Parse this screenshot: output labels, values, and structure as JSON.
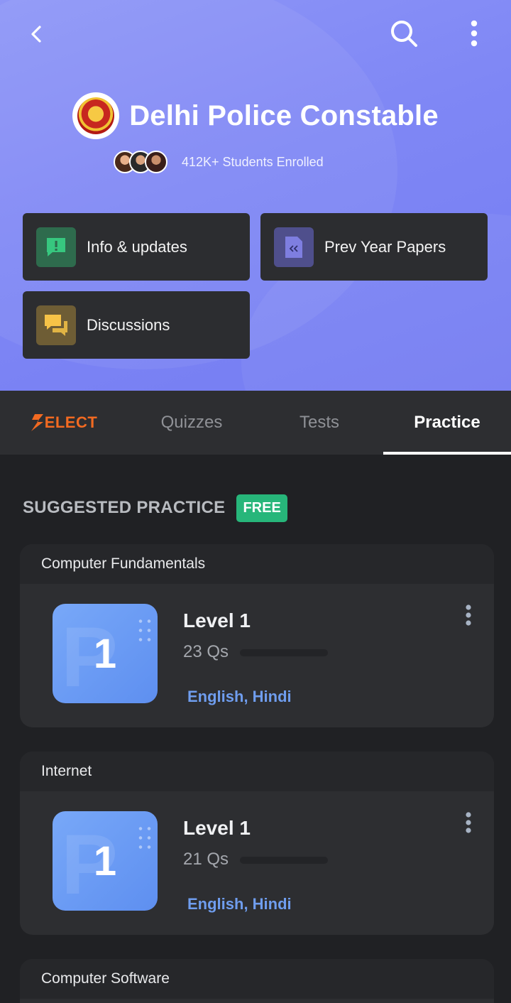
{
  "header": {
    "title": "Delhi Police Constable",
    "enrolled_text": "412K+ Students Enrolled",
    "actions": [
      {
        "label": "Info & updates",
        "icon": "info-message-icon"
      },
      {
        "label": "Prev Year Papers",
        "icon": "document-icon"
      },
      {
        "label": "Discussions",
        "icon": "chat-bubbles-icon"
      }
    ]
  },
  "tabs": [
    {
      "label": "ELECT",
      "brand_letter": "S",
      "active": false
    },
    {
      "label": "Quizzes",
      "active": false
    },
    {
      "label": "Tests",
      "active": false
    },
    {
      "label": "Practice",
      "active": true
    }
  ],
  "section": {
    "title": "SUGGESTED PRACTICE",
    "badge": "FREE"
  },
  "cards": [
    {
      "topic": "Computer Fundamentals",
      "thumb_number": "1",
      "level": "Level 1",
      "questions": "23 Qs",
      "languages": "English, Hindi"
    },
    {
      "topic": "Internet",
      "thumb_number": "1",
      "level": "Level 1",
      "questions": "21 Qs",
      "languages": "English, Hindi"
    },
    {
      "topic": "Computer Software"
    }
  ],
  "colors": {
    "header_gradient": "#8088f5",
    "brand_orange": "#f26a21",
    "free_green": "#27b67a",
    "link_blue": "#6f9dee",
    "card_bg": "#2d2e31"
  }
}
